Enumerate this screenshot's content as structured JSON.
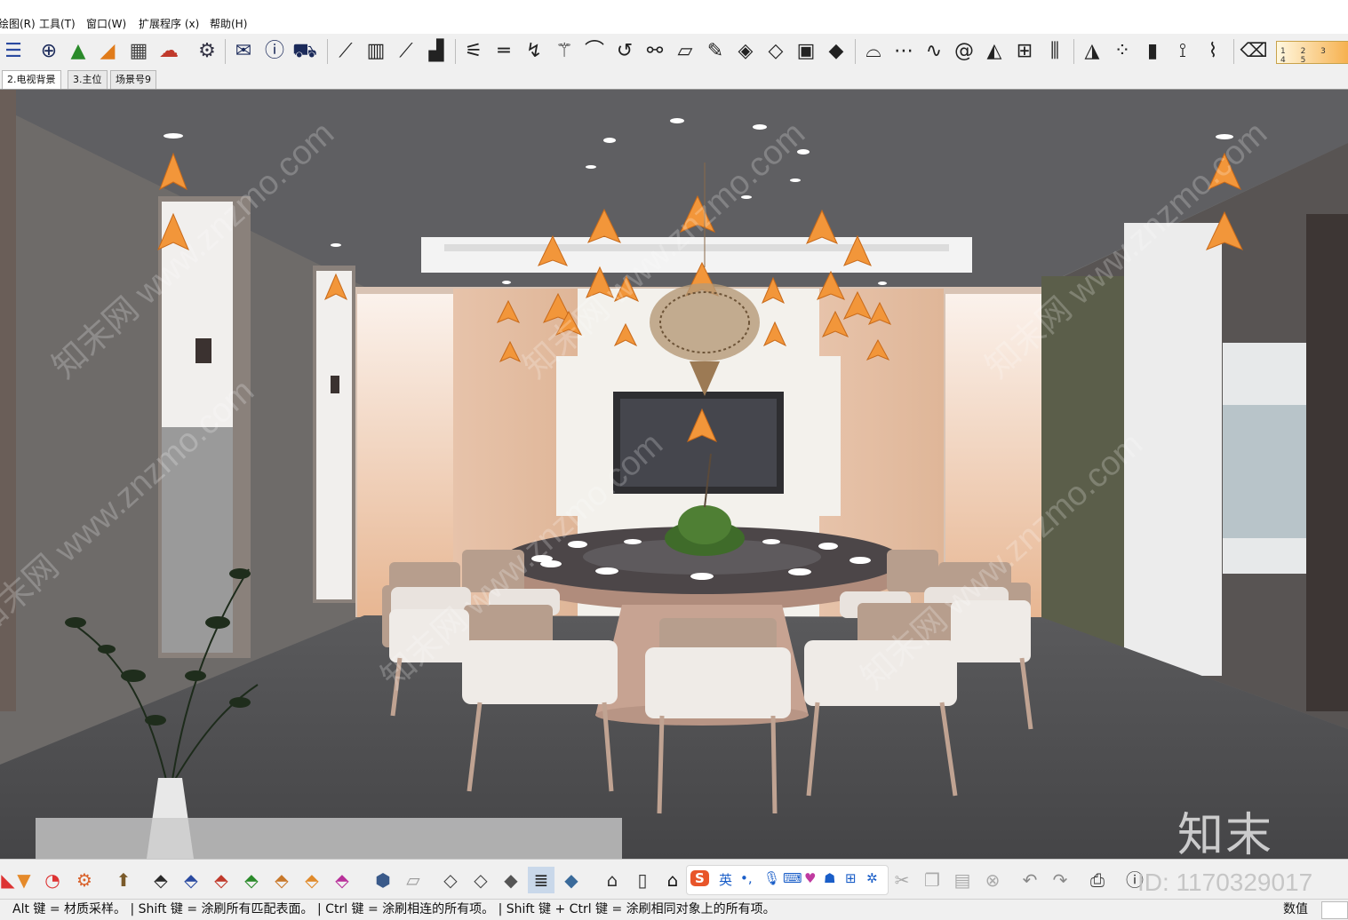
{
  "menu": {
    "items": [
      "绘图(R)",
      "工具(T)",
      "窗口(W)",
      "扩展程序 (x)",
      "帮助(H)"
    ]
  },
  "toolbar": {
    "top_icons": [
      "layers-icon",
      "add-circle-icon",
      "tree-icon",
      "rainbow-icon",
      "checker-sphere-icon",
      "cloud-upload-icon",
      "gears-icon",
      "mail-icon",
      "info-icon",
      "cart-icon",
      "stairs-icon",
      "column-icon",
      "ramp-icon",
      "bar-graph-icon",
      "joint-icon",
      "line-tool-icon",
      "curve-tool-icon",
      "branch-icon",
      "arc-icon",
      "spiral-icon",
      "sweep-icon",
      "slab-icon",
      "pen-icon",
      "layer-stack-icon",
      "layer-flat-icon",
      "box-paint-icon",
      "layer-edit-icon",
      "arch-icon",
      "dots-line-icon",
      "wave-icon",
      "spiral-coil-icon",
      "wall-icon",
      "bench-icon",
      "colonnade-icon",
      "mirror-icon",
      "grid-dots-icon",
      "door-icon",
      "compass-icon",
      "brush-icon",
      "eraser-icon"
    ],
    "scale_ticks": "1 2 3 4 5"
  },
  "tabs": [
    {
      "label": "2.电视背景",
      "active": true
    },
    {
      "label": "3.主位",
      "active": false
    },
    {
      "label": "场景号9",
      "active": false
    }
  ],
  "viewport": {
    "watermark": "知末网 www.znzmo.com",
    "corner_watermark": "知末"
  },
  "bottom_toolbar": {
    "icons": [
      "paint-bucket-icon",
      "paint-drip-icon",
      "gear-color-icon",
      "push-up-icon",
      "push-e-icon",
      "push-j-icon",
      "push-r-icon",
      "push-v-icon",
      "push-n-icon",
      "push-x-icon",
      "push-f-icon",
      "iso-view-icon",
      "top-view-icon",
      "front-view-icon",
      "right-view-icon",
      "back-view-icon",
      "left-view-icon",
      "bottom-view-icon",
      "house-icon",
      "door-open-icon",
      "home-icon",
      "walk-icon",
      "folder-icon",
      "search-icon",
      "wand-icon",
      "save-icon",
      "scissors-icon",
      "copy-icon",
      "paste-icon",
      "close-circle-icon",
      "undo-icon",
      "redo-icon",
      "print-icon",
      "help-icon"
    ],
    "ime": {
      "logo": "S",
      "lang": "英",
      "symbols": "•,",
      "extras": [
        "mic-icon",
        "keyboard-icon",
        "skin-icon",
        "game-icon",
        "grid-apps-icon",
        "settings-icon"
      ]
    },
    "id_text": "ID: 1170329017"
  },
  "status": {
    "hint": "Alt 键 = 材质采样。 | Shift 键 = 涂刷所有匹配表面。 | Ctrl 键 = 涂刷相连的所有项。 | Shift 键 + Ctrl 键 = 涂刷相同对象上的所有项。",
    "value_label": "数值",
    "value": ""
  },
  "colors": {
    "ceiling": "#5f5f62",
    "floor": "#4e4e51",
    "wood_panel": "#e8c4ab",
    "accent_orange": "#f2963a"
  }
}
